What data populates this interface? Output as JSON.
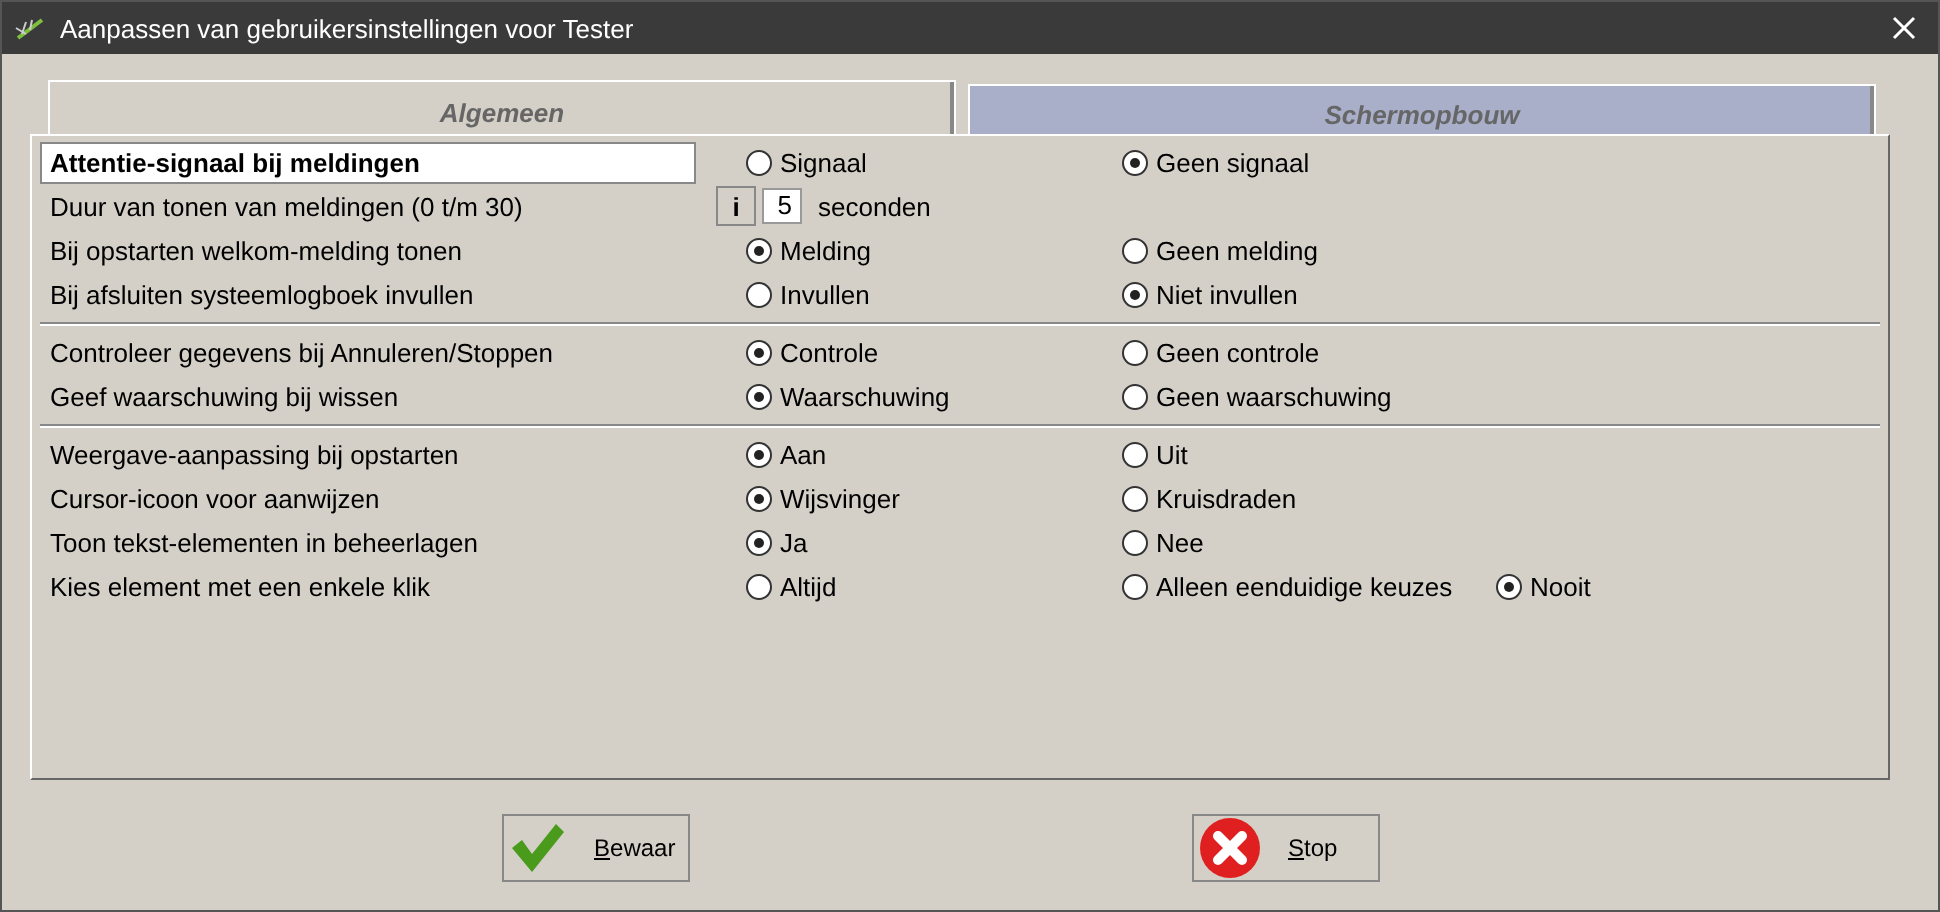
{
  "window": {
    "title": "Aanpassen van gebruikersinstellingen voor Tester"
  },
  "tabs": [
    {
      "label": "Algemeen",
      "selected": true
    },
    {
      "label": "Schermopbouw",
      "selected": false
    }
  ],
  "groups": [
    {
      "rows": [
        {
          "kind": "radio",
          "label": "Attentie-signaal bij meldingen",
          "selected": true,
          "options": [
            {
              "label": "Signaal",
              "selected": false
            },
            {
              "label": "Geen signaal",
              "selected": true
            }
          ]
        },
        {
          "kind": "number",
          "label": "Duur van tonen van meldingen (0 t/m 30)",
          "selected": false,
          "info": "i",
          "value": "5",
          "unit": "seconden"
        },
        {
          "kind": "radio",
          "label": "Bij opstarten welkom-melding tonen",
          "selected": false,
          "options": [
            {
              "label": "Melding",
              "selected": true
            },
            {
              "label": "Geen melding",
              "selected": false
            }
          ]
        },
        {
          "kind": "radio",
          "label": "Bij afsluiten systeemlogboek invullen",
          "selected": false,
          "options": [
            {
              "label": "Invullen",
              "selected": false
            },
            {
              "label": "Niet invullen",
              "selected": true
            }
          ]
        }
      ]
    },
    {
      "rows": [
        {
          "kind": "radio",
          "label": "Controleer gegevens bij Annuleren/Stoppen",
          "selected": false,
          "options": [
            {
              "label": "Controle",
              "selected": true
            },
            {
              "label": "Geen controle",
              "selected": false
            }
          ]
        },
        {
          "kind": "radio",
          "label": "Geef waarschuwing bij wissen",
          "selected": false,
          "options": [
            {
              "label": "Waarschuwing",
              "selected": true
            },
            {
              "label": "Geen waarschuwing",
              "selected": false
            }
          ]
        }
      ]
    },
    {
      "rows": [
        {
          "kind": "radio",
          "label": "Weergave-aanpassing bij opstarten",
          "selected": false,
          "options": [
            {
              "label": "Aan",
              "selected": true
            },
            {
              "label": "Uit",
              "selected": false
            }
          ]
        },
        {
          "kind": "radio",
          "label": "Cursor-icoon voor aanwijzen",
          "selected": false,
          "options": [
            {
              "label": "Wijsvinger",
              "selected": true
            },
            {
              "label": "Kruisdraden",
              "selected": false
            }
          ]
        },
        {
          "kind": "radio",
          "label": "Toon tekst-elementen in beheerlagen",
          "selected": false,
          "options": [
            {
              "label": "Ja",
              "selected": true
            },
            {
              "label": "Nee",
              "selected": false
            }
          ]
        },
        {
          "kind": "radio",
          "label": "Kies element met een enkele klik",
          "selected": false,
          "options": [
            {
              "label": "Altijd",
              "selected": false
            },
            {
              "label": "Alleen eenduidige keuzes",
              "selected": false
            },
            {
              "label": "Nooit",
              "selected": true
            }
          ]
        }
      ]
    }
  ],
  "buttons": [
    {
      "kind": "save",
      "label": "Bewaar"
    },
    {
      "kind": "stop",
      "label": "Stop"
    }
  ]
}
